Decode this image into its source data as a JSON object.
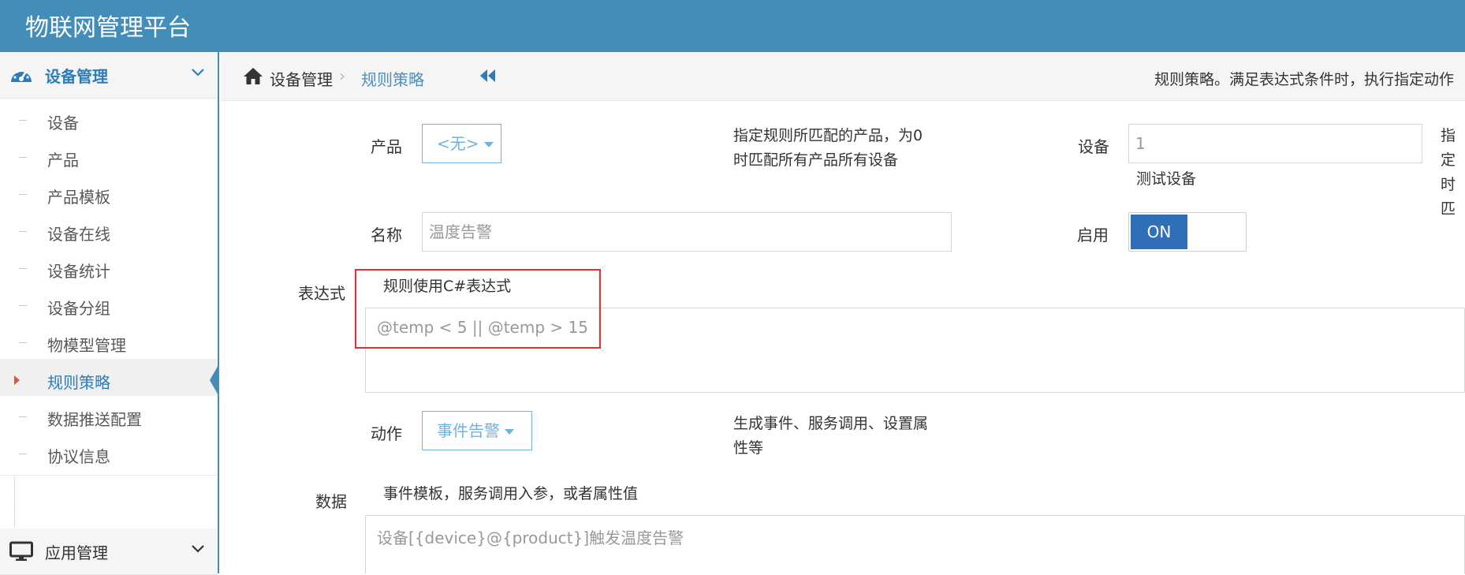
{
  "app": {
    "title": "物联网管理平台"
  },
  "colors": {
    "header": "#438eb9",
    "accent": "#2b7dbc",
    "toggle_on": "#2e6fb8",
    "highlight_box": "#e03030"
  },
  "sidebar": {
    "groups": [
      {
        "label": "设备管理",
        "icon": "dashboard-icon",
        "expanded": true
      },
      {
        "label": "应用管理",
        "icon": "desktop-icon",
        "expanded": false
      }
    ],
    "items": [
      {
        "label": "设备"
      },
      {
        "label": "产品"
      },
      {
        "label": "产品模板"
      },
      {
        "label": "设备在线"
      },
      {
        "label": "设备统计"
      },
      {
        "label": "设备分组"
      },
      {
        "label": "物模型管理"
      },
      {
        "label": "规则策略",
        "active": true
      },
      {
        "label": "数据推送配置"
      },
      {
        "label": "协议信息"
      }
    ]
  },
  "breadcrumb": {
    "home_icon": "home-icon",
    "parent": "设备管理",
    "separator": "›",
    "current": "规则策略",
    "description": "规则策略。满足表达式条件时，执行指定动作"
  },
  "form": {
    "product": {
      "label": "产品",
      "value": "<无>",
      "hint": [
        "指定规则所匹配的产品，为0",
        "时匹配所有产品所有设备"
      ]
    },
    "device": {
      "label": "设备",
      "value": "1",
      "sub": "测试设备",
      "hint": [
        "指定",
        "时匹"
      ]
    },
    "name": {
      "label": "名称",
      "value": "温度告警"
    },
    "enable": {
      "label": "启用",
      "value": "ON"
    },
    "expression": {
      "label": "表达式",
      "hint": "规则使用C#表达式",
      "value": "@temp < 5 || @temp > 15"
    },
    "action": {
      "label": "动作",
      "value": "事件告警",
      "hint": [
        "生成事件、服务调用、设置属",
        "性等"
      ]
    },
    "data": {
      "label": "数据",
      "hint": "事件模板，服务调用入参，或者属性值",
      "value": "设备[{device}@{product}]触发温度告警"
    }
  }
}
